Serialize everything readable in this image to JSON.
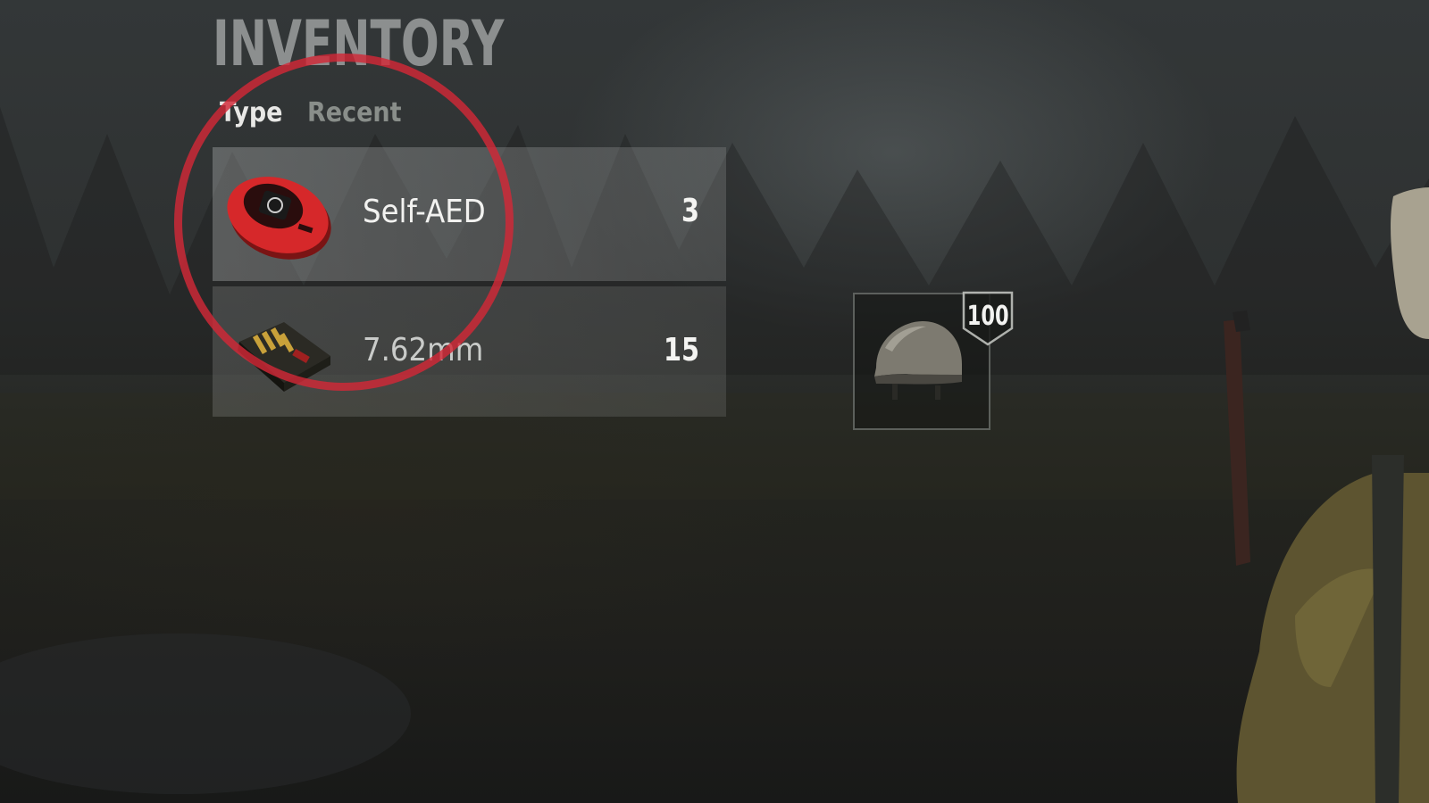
{
  "inventory": {
    "title": "INVENTORY",
    "tabs": [
      {
        "label": "Type",
        "active": true
      },
      {
        "label": "Recent",
        "active": false
      }
    ],
    "items": [
      {
        "icon": "aed-icon",
        "name": "Self-AED",
        "count": "3"
      },
      {
        "icon": "ammo-box-icon",
        "name": "7.62mm",
        "count": "15"
      }
    ]
  },
  "equipment": {
    "helmet": {
      "icon": "helmet-icon",
      "durability": "100"
    }
  },
  "colors": {
    "highlight": "#d22837",
    "text": "#f2f2f0"
  }
}
